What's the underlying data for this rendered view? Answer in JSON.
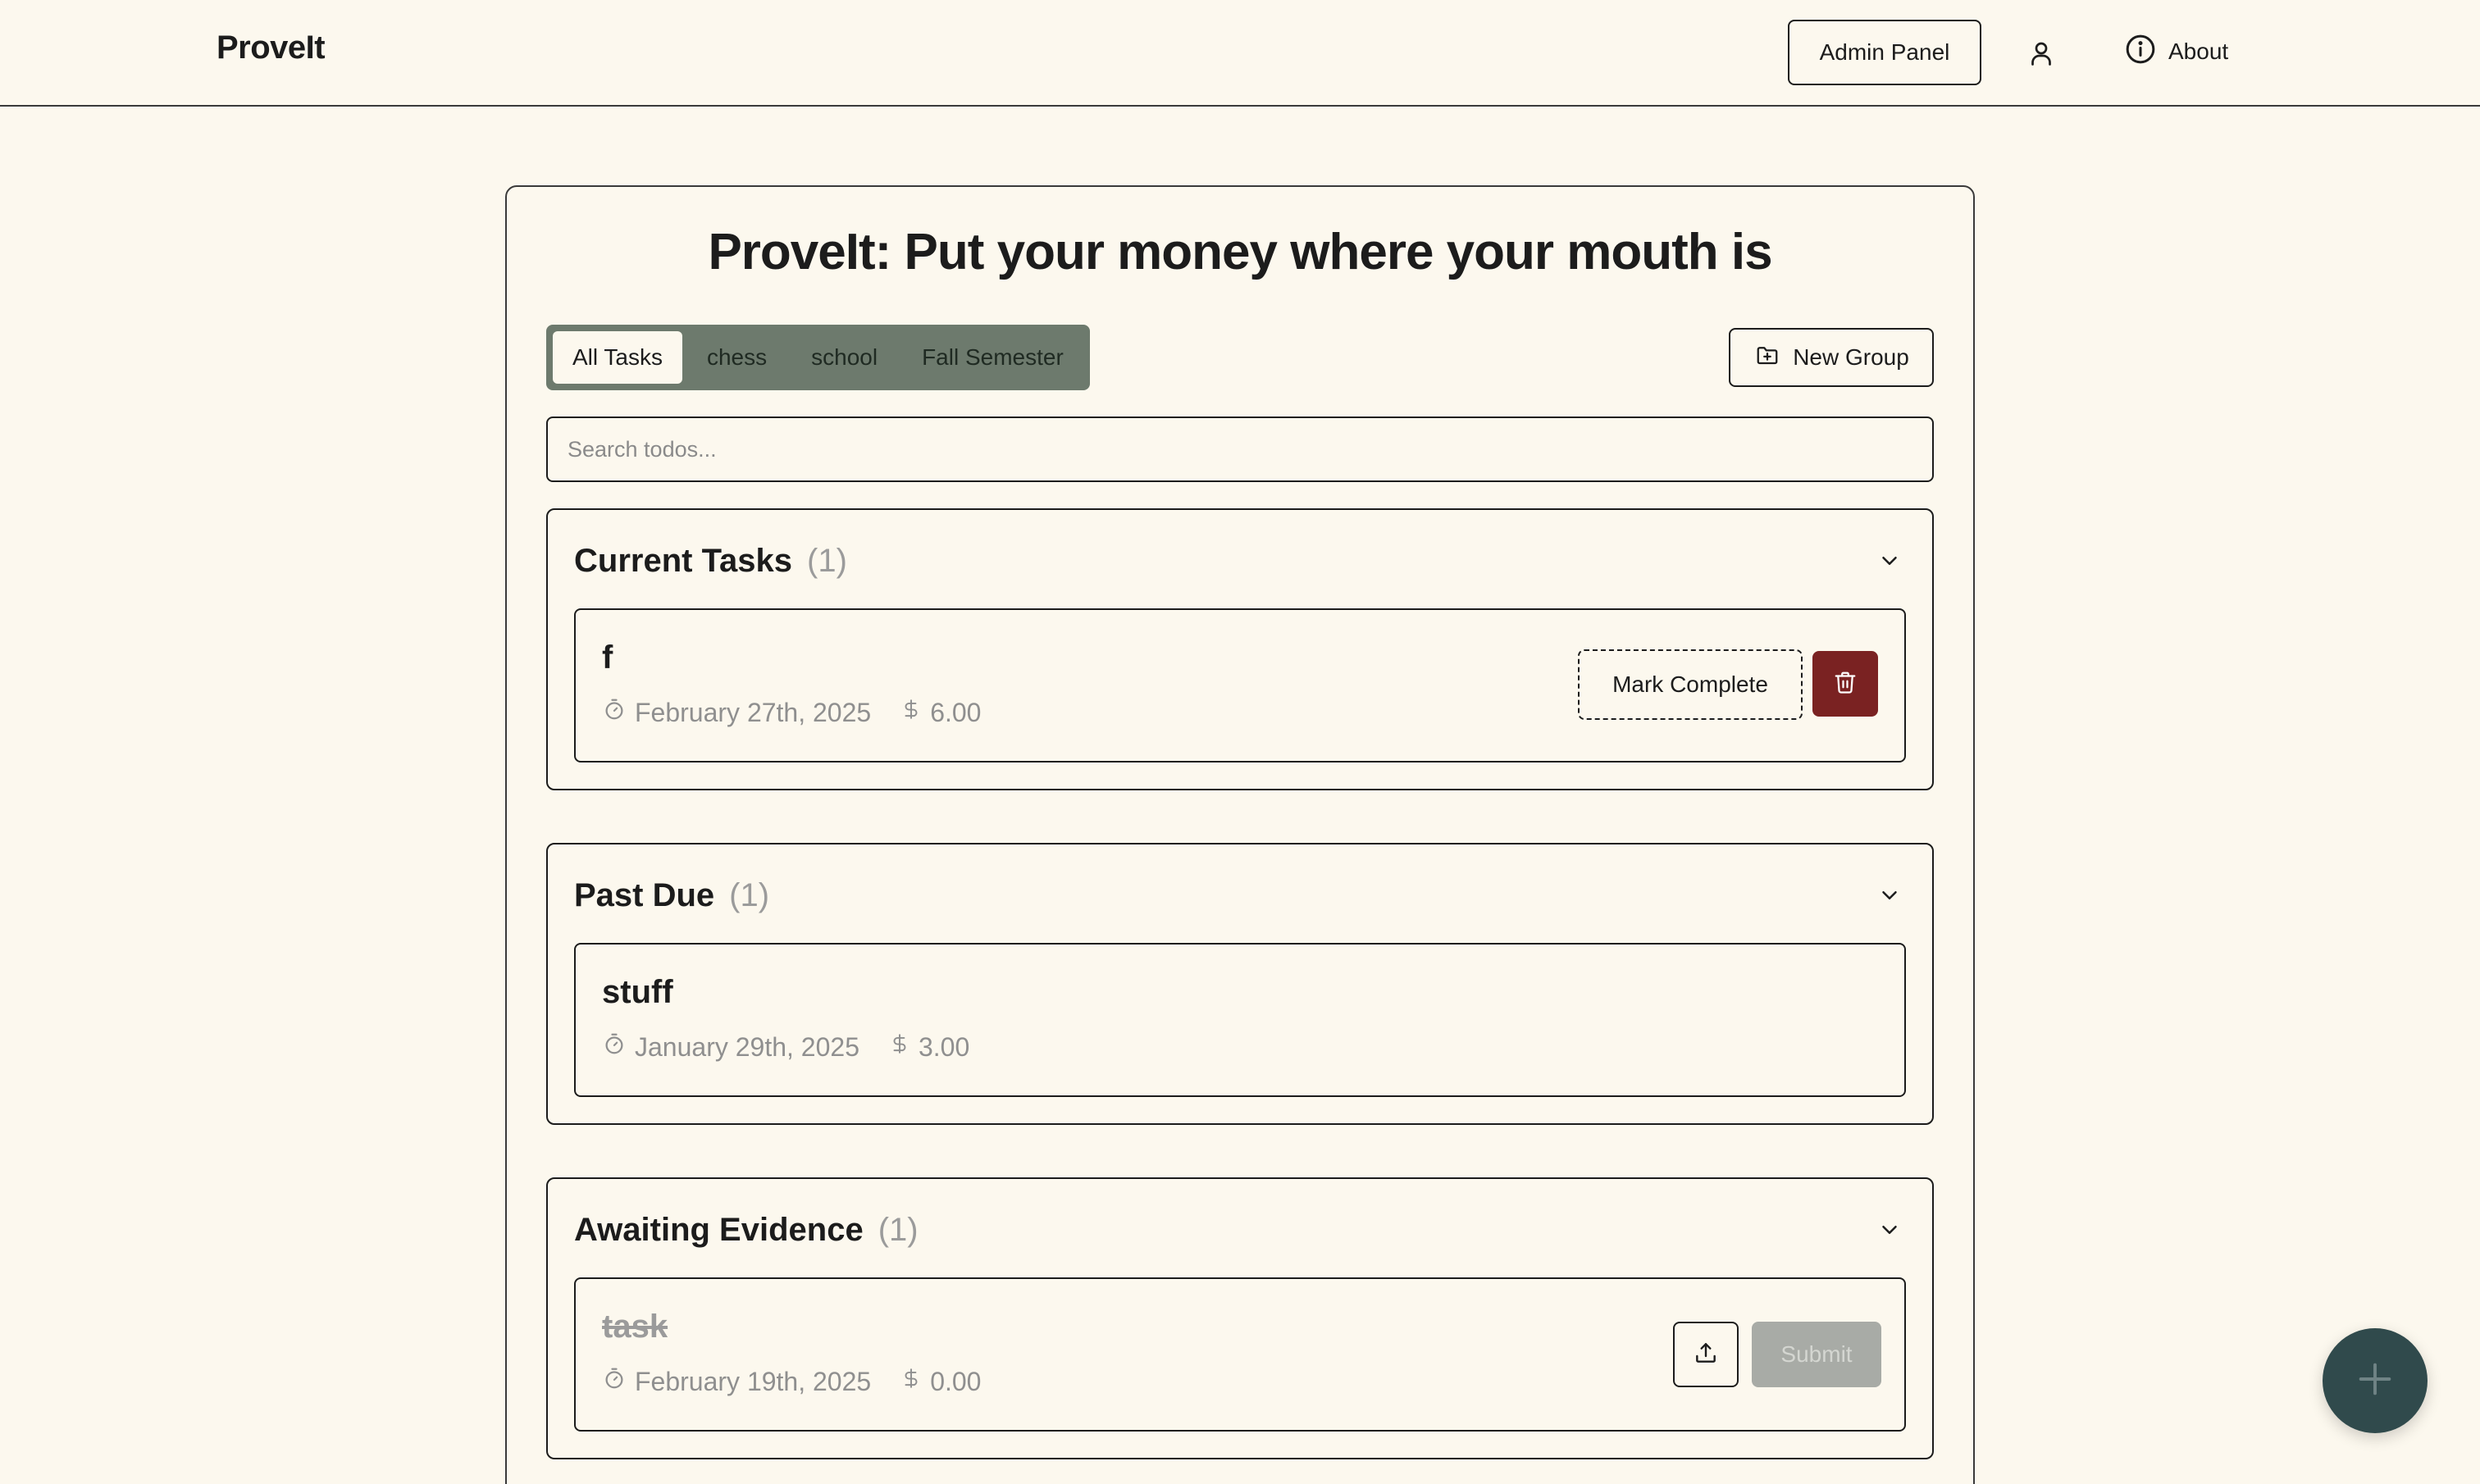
{
  "app": {
    "brand": "ProveIt"
  },
  "header": {
    "admin_label": "Admin Panel",
    "about_label": "About",
    "user_icon": "user-icon",
    "about_icon": "info-icon"
  },
  "main": {
    "title": "ProveIt: Put your money where your mouth is",
    "tabs": [
      {
        "label": "All Tasks",
        "active": true
      },
      {
        "label": "chess",
        "active": false
      },
      {
        "label": "school",
        "active": false
      },
      {
        "label": "Fall Semester",
        "active": false
      }
    ],
    "new_group_label": "New Group",
    "search": {
      "placeholder": "Search todos...",
      "value": ""
    }
  },
  "sections": {
    "current": {
      "title": "Current Tasks",
      "count": "(1)",
      "tasks": [
        {
          "name": "f",
          "date": "February 27th, 2025",
          "amount": "6.00",
          "mark_label": "Mark Complete"
        }
      ]
    },
    "past_due": {
      "title": "Past Due",
      "count": "(1)",
      "tasks": [
        {
          "name": "stuff",
          "date": "January 29th, 2025",
          "amount": "3.00"
        }
      ]
    },
    "awaiting": {
      "title": "Awaiting Evidence",
      "count": "(1)",
      "tasks": [
        {
          "name": "task",
          "date": "February 19th, 2025",
          "amount": "0.00",
          "submit_label": "Submit"
        }
      ]
    }
  },
  "colors": {
    "background": "#fcf8ee",
    "tab_bar": "#6d7a6d",
    "delete": "#7a2222",
    "fab": "#304a4c",
    "muted": "#9b9b9b"
  }
}
